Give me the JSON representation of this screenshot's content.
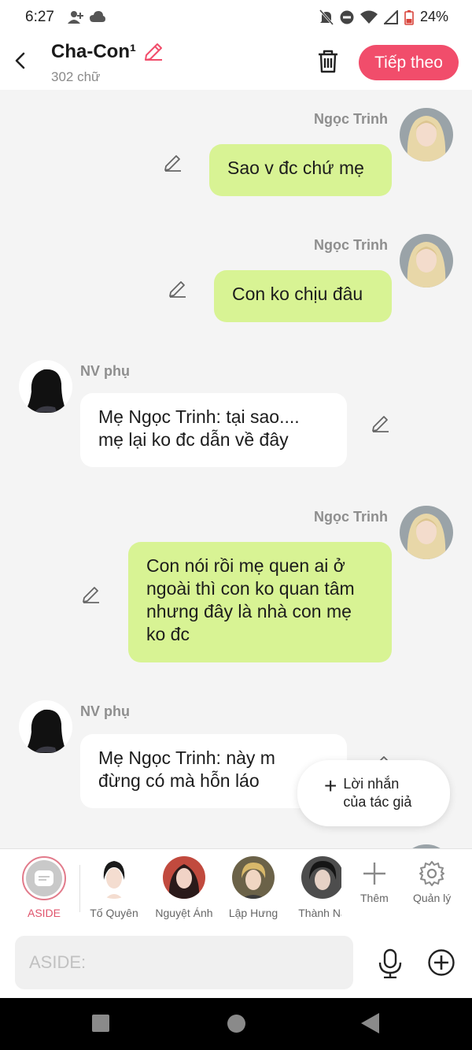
{
  "status_bar": {
    "time": "6:27",
    "battery": "24%"
  },
  "header": {
    "title": "Cha-Con¹",
    "word_count": "302 chữ",
    "next_label": "Tiếp theo"
  },
  "messages": [
    {
      "sender": "Ngọc Trinh",
      "text": "Sao v đc chứ mẹ",
      "side": "right"
    },
    {
      "sender": "Ngọc Trinh",
      "text": "Con ko chịu đâu",
      "side": "right"
    },
    {
      "sender": "NV phụ",
      "line1": "Mẹ Ngọc Trinh: tại sao....",
      "line2": "mẹ lại ko đc dẫn về đây",
      "side": "left"
    },
    {
      "sender": "Ngọc Trinh",
      "line1": "Con nói rồi mẹ quen ai ở",
      "line2": "ngoài thì con ko quan tâm",
      "line3": "nhưng đây là nhà con mẹ",
      "line4": "ko đc",
      "side": "right"
    },
    {
      "sender": "NV phụ",
      "line1": "Mẹ Ngọc Trinh: này m",
      "line2": "đừng có mà hỗn láo",
      "side": "left"
    }
  ],
  "floating_button": {
    "line1": "Lời nhắn",
    "line2": "của tác giả"
  },
  "characters": [
    {
      "label": "ASIDE"
    },
    {
      "label": "Tố Quyên"
    },
    {
      "label": "Nguyệt Ánh"
    },
    {
      "label": "Lập Hưng"
    },
    {
      "label": "Thành Na"
    }
  ],
  "tools": {
    "add_label": "Thêm",
    "manage_label": "Quản lý"
  },
  "input": {
    "placeholder": "ASIDE:"
  },
  "colors": {
    "accent": "#f14d6b",
    "bubble_mine": "#d8f394",
    "bubble_other": "#ffffff",
    "background": "#f4f4f4"
  }
}
